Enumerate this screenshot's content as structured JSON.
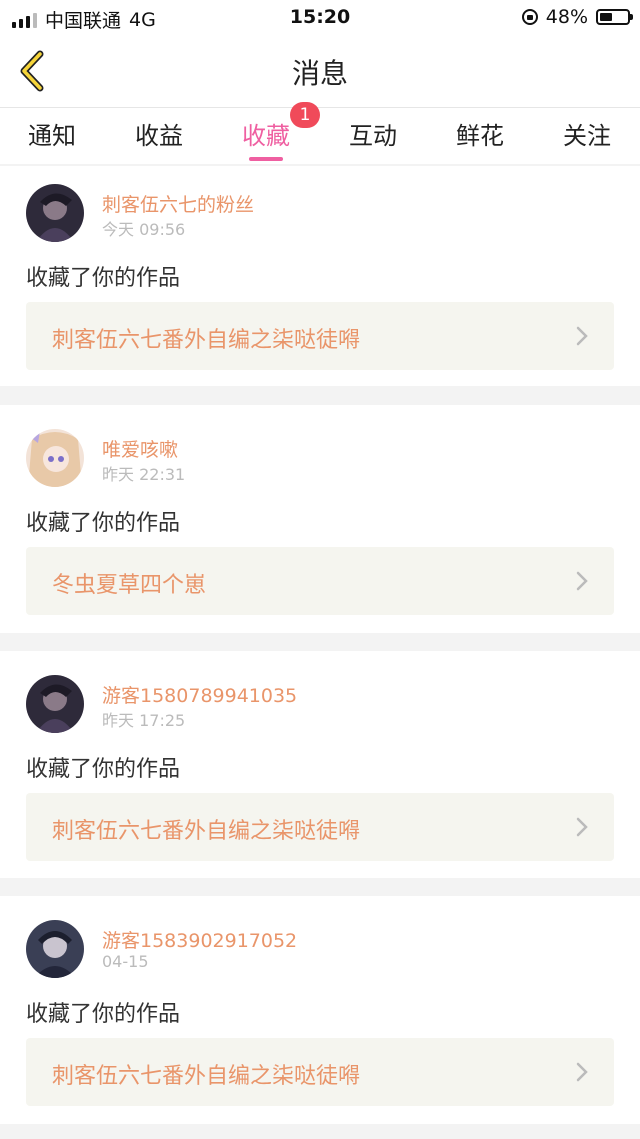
{
  "status_bar": {
    "carrier": "中国联通",
    "network": "4G",
    "time": "15:20",
    "battery_percent": "48%",
    "battery_level": 0.48
  },
  "navbar": {
    "title": "消息",
    "back_icon": "chevron-left-icon"
  },
  "tabs": {
    "items": [
      {
        "label": "通知"
      },
      {
        "label": "收益"
      },
      {
        "label": "收藏",
        "badge": "1"
      },
      {
        "label": "互动"
      },
      {
        "label": "鲜花"
      },
      {
        "label": "关注"
      }
    ],
    "active": "收藏"
  },
  "messages": [
    {
      "user": "刺客伍六七的粉丝",
      "time": "今天 09:56",
      "action": "收藏了你的作品",
      "work": "刺客伍六七番外自编之柒哒徒嘚"
    },
    {
      "user": "唯爱咳嗽",
      "time": "昨天 22:31",
      "action": "收藏了你的作品",
      "work": "冬虫夏草四个崽"
    },
    {
      "user": "游客1580789941035",
      "time": "昨天 17:25",
      "action": "收藏了你的作品",
      "work": "刺客伍六七番外自编之柒哒徒嘚"
    },
    {
      "user": "游客1583902917052",
      "time": "04-15",
      "action": "收藏了你的作品",
      "work": "刺客伍六七番外自编之柒哒徒嘚"
    }
  ],
  "colors": {
    "accent_pink": "#ef5fa1",
    "username_orange": "#e9956a",
    "badge_red": "#f04a5a",
    "work_box_bg": "#f5f5ef"
  }
}
